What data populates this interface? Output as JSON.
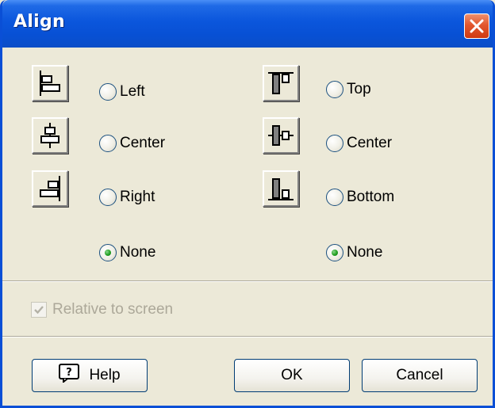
{
  "window": {
    "title": "Align"
  },
  "horizontal": {
    "options": [
      {
        "label": "Left",
        "icon": "align-left-icon",
        "selected": false
      },
      {
        "label": "Center",
        "icon": "align-center-horizontal-icon",
        "selected": false
      },
      {
        "label": "Right",
        "icon": "align-right-icon",
        "selected": false
      },
      {
        "label": "None",
        "selected": true
      }
    ]
  },
  "vertical": {
    "options": [
      {
        "label": "Top",
        "icon": "align-top-icon",
        "selected": false
      },
      {
        "label": "Center",
        "icon": "align-center-vertical-icon",
        "selected": false
      },
      {
        "label": "Bottom",
        "icon": "align-bottom-icon",
        "selected": false
      },
      {
        "label": "None",
        "selected": true
      }
    ]
  },
  "relative": {
    "label": "Relative to screen",
    "checked": true,
    "enabled": false
  },
  "buttons": {
    "help": "Help",
    "ok": "OK",
    "cancel": "Cancel"
  },
  "colors": {
    "titlebar": "#0b56dc",
    "face": "#ece9d8",
    "close": "#e2572e",
    "radio_dot": "#21a121",
    "disabled_text": "#aca899"
  }
}
